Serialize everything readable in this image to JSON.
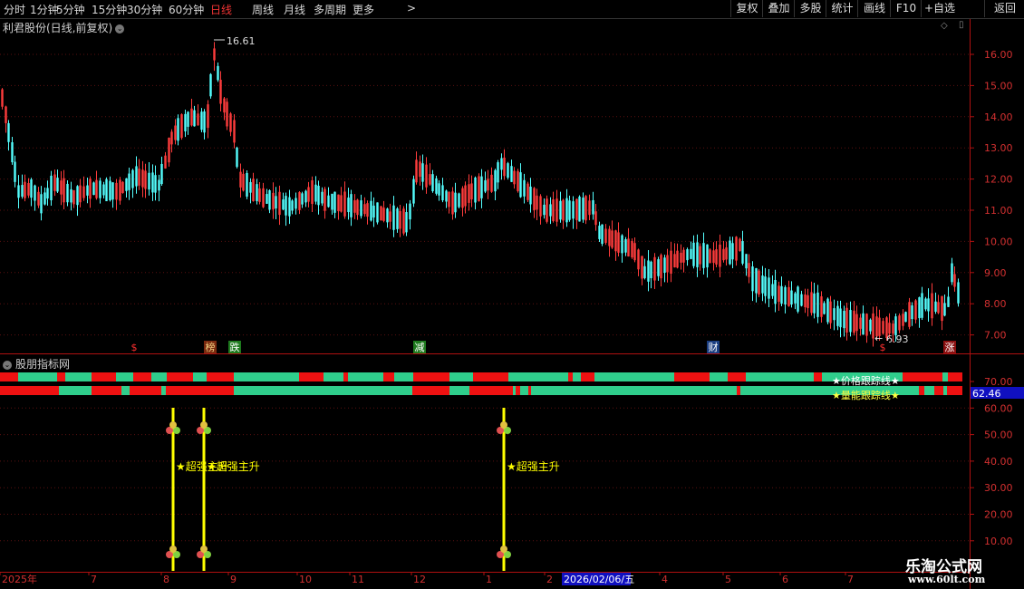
{
  "toolbar": {
    "periods": [
      "分时",
      "1分钟",
      "5分钟",
      "15分钟",
      "30分钟",
      "60分钟",
      "日线",
      "周线",
      "月线",
      "多周期",
      "更多"
    ],
    "active_period": "日线",
    "more_chevron": ">",
    "buttons": [
      "复权",
      "叠加",
      "多股",
      "统计",
      "画线",
      "F10",
      "+自选",
      "返回"
    ]
  },
  "stock": {
    "title": "利君股份(日线,前复权)",
    "high_label": "16.61",
    "low_label": "6.93"
  },
  "indicator": {
    "title": "股朋指标网",
    "line1_label": "★价格跟踪线★",
    "line2_label": "★量能跟踪线★",
    "current_value": "62.46",
    "signal_text": "★超强主升"
  },
  "event_markers": [
    {
      "text": "$",
      "color": "#ff3030",
      "bg": "#000000"
    },
    {
      "text": "榜",
      "color": "#f0d080",
      "bg": "#7a2a10"
    },
    {
      "text": "跌",
      "color": "#ffffff",
      "bg": "#1e7a1e"
    },
    {
      "text": "减",
      "color": "#ffffff",
      "bg": "#1e7a1e"
    },
    {
      "text": "财",
      "color": "#ffffff",
      "bg": "#1a3d80"
    },
    {
      "text": "$",
      "color": "#ff3030",
      "bg": "#000000"
    },
    {
      "text": "涨",
      "color": "#ffffff",
      "bg": "#8a1010"
    }
  ],
  "price_axis": [
    "16.00",
    "15.00",
    "14.00",
    "13.00",
    "12.00",
    "11.00",
    "10.00",
    "9.00",
    "8.00",
    "7.00"
  ],
  "indicator_axis": [
    "70.00",
    "60.00",
    "50.00",
    "40.00",
    "30.00",
    "20.00",
    "10.00"
  ],
  "time_axis": {
    "labels": [
      "2025年",
      "7",
      "8",
      "9",
      "10",
      "11",
      "12",
      "1",
      "2",
      "2026/02/06/五",
      "4",
      "5",
      "6",
      "7"
    ],
    "highlight": "2026/02/06/五"
  },
  "watermark": {
    "line1": "乐淘公式网",
    "line2": "www.60lt.com"
  },
  "colors": {
    "up": "#ff3c3c",
    "down": "#54ffff",
    "band_red": "#ee1111",
    "band_green": "#2fce8c",
    "signal": "#ffff00",
    "axis": "#b01010"
  }
}
